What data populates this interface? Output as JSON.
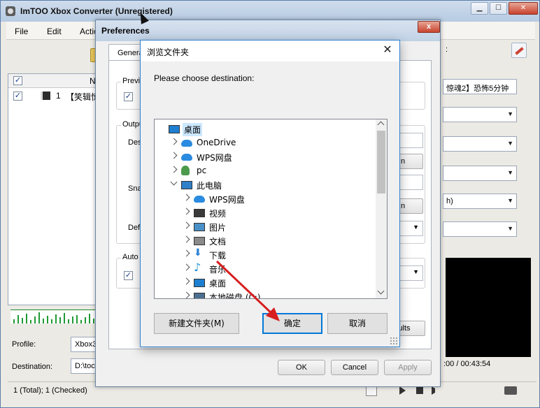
{
  "main_window": {
    "title": "ImTOO Xbox Converter (Unregistered)",
    "menu": [
      "File",
      "Edit",
      "Actio"
    ],
    "list": {
      "header_name": "N",
      "rows": [
        {
          "index": "1",
          "name": "【笑辑惊魂2】恐怖5分钟",
          "checked": true
        }
      ]
    },
    "profile_label": "Profile:",
    "profile_value": "Xbox3",
    "destination_label": "Destination:",
    "destination_value": "D:\\toc",
    "status": "1 (Total); 1 (Checked)",
    "right_panel": {
      "header_fragment": ":",
      "name_field": "惊魂2】恐怖5分钟",
      "dropdown_4_text": "h)"
    },
    "time_readout": ":00 / 00:43:54"
  },
  "preferences": {
    "title": "Preferences",
    "close_label": "x",
    "tab": "Genera",
    "groups": {
      "preview": "Previe",
      "output": "Outpu",
      "auto": "Auto"
    },
    "labels": {
      "destination": "Des",
      "snapshot": "Sna",
      "default": "Def"
    },
    "side_buttons": [
      "n",
      "n"
    ],
    "defaults_button": "ults",
    "ok": "OK",
    "cancel": "Cancel",
    "apply": "Apply"
  },
  "browse_dialog": {
    "title": "浏览文件夹",
    "close_symbol": "✕",
    "prompt": "Please choose destination:",
    "tree": [
      {
        "label": "桌面",
        "icon": "desktop-icon",
        "level": 0,
        "expander": "none",
        "selected": true
      },
      {
        "label": "OneDrive",
        "icon": "cloud-icon",
        "level": 1,
        "expander": "collapsed"
      },
      {
        "label": "WPS网盘",
        "icon": "cloud-icon",
        "level": 1,
        "expander": "collapsed"
      },
      {
        "label": "pc",
        "icon": "user-icon",
        "level": 1,
        "expander": "collapsed"
      },
      {
        "label": "此电脑",
        "icon": "computer-icon",
        "level": 1,
        "expander": "expanded"
      },
      {
        "label": "WPS网盘",
        "icon": "cloud-icon",
        "level": 2,
        "expander": "collapsed"
      },
      {
        "label": "视频",
        "icon": "video-icon",
        "level": 2,
        "expander": "collapsed"
      },
      {
        "label": "图片",
        "icon": "picture-icon",
        "level": 2,
        "expander": "collapsed"
      },
      {
        "label": "文档",
        "icon": "document-icon",
        "level": 2,
        "expander": "collapsed"
      },
      {
        "label": "下载",
        "icon": "download-icon",
        "level": 2,
        "expander": "collapsed"
      },
      {
        "label": "音乐",
        "icon": "music-icon",
        "level": 2,
        "expander": "collapsed"
      },
      {
        "label": "桌面",
        "icon": "desktop-icon",
        "level": 2,
        "expander": "collapsed"
      },
      {
        "label": "本地磁盘 (C:)",
        "icon": "disk-icon",
        "level": 2,
        "expander": "collapsed"
      }
    ],
    "new_folder": "新建文件夹(M)",
    "ok": "确定",
    "cancel": "取消"
  },
  "colors": {
    "selection": "#cce8ff",
    "annotation_arrow": "#d71f1f",
    "focus_border": "#0078d7"
  }
}
